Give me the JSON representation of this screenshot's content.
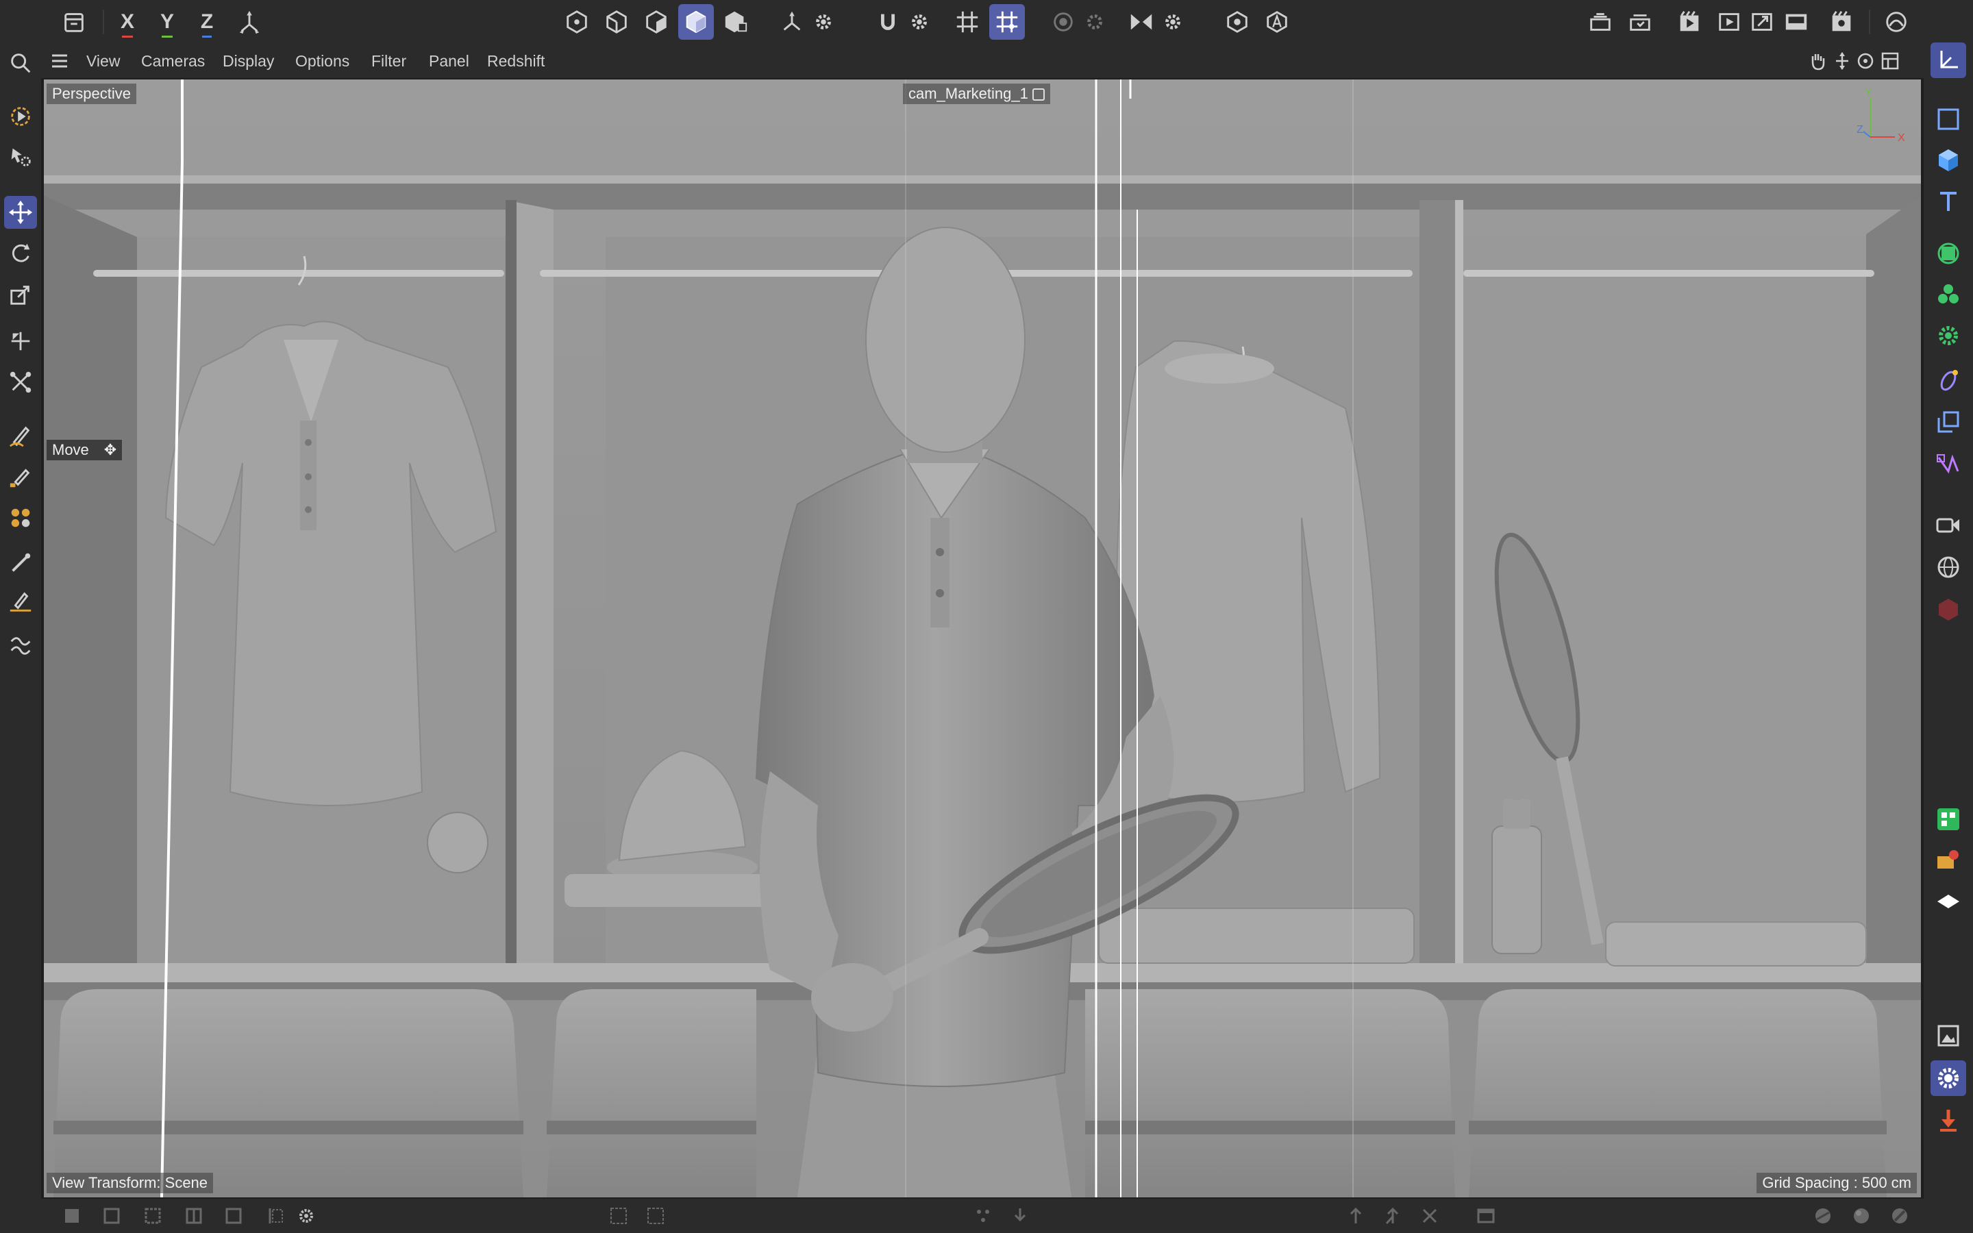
{
  "top_toolbar": {
    "undo_icon": "history-icon",
    "axis_x": "X",
    "axis_y": "Y",
    "axis_z": "Z",
    "coordinate_system_icon": "coordinate-system-icon",
    "modes": [
      "points-mode-icon",
      "edges-mode-icon",
      "polygons-mode-icon",
      "model-mode-icon",
      "texture-mode-icon"
    ],
    "active_mode": "model",
    "right_icons": [
      "render-queue-icon",
      "render-region-icon",
      "render-view-icon",
      "render-viewer-icon",
      "picture-viewer-icon",
      "rv-icon",
      "render-settings-icon",
      "layout-icon"
    ]
  },
  "viewport_menu": {
    "items": [
      "View",
      "Cameras",
      "Display",
      "Options",
      "Filter",
      "Panel",
      "Redshift"
    ]
  },
  "viewport": {
    "projection": "Perspective",
    "camera_name": "cam_Marketing_1",
    "active_tool": "Move",
    "view_transform": "View Transform: Scene",
    "grid_spacing": "Grid Spacing : 500 cm",
    "axis_gizmo": {
      "y": "Y",
      "z": "Z",
      "x": "X"
    }
  },
  "colors": {
    "accent": "#5560a8",
    "ui_background": "#2b2b2b",
    "viewport_background": "#9a9a9a",
    "axis_x": "#d9473f",
    "axis_y": "#6fbe44",
    "axis_z": "#4a7fd9",
    "object_green": "#3fc46a"
  }
}
